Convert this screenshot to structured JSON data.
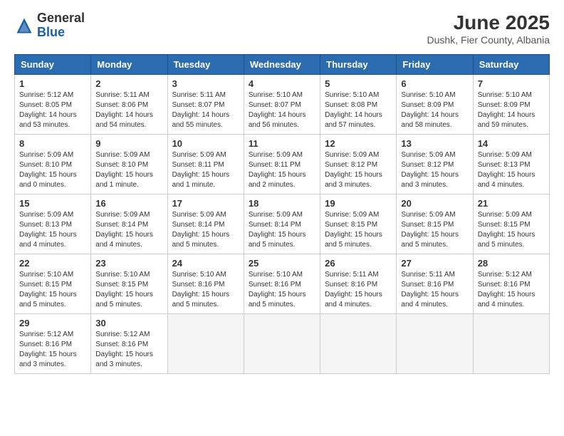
{
  "header": {
    "logo_general": "General",
    "logo_blue": "Blue",
    "title": "June 2025",
    "subtitle": "Dushk, Fier County, Albania"
  },
  "weekdays": [
    "Sunday",
    "Monday",
    "Tuesday",
    "Wednesday",
    "Thursday",
    "Friday",
    "Saturday"
  ],
  "weeks": [
    [
      {
        "day": "1",
        "info": "Sunrise: 5:12 AM\nSunset: 8:05 PM\nDaylight: 14 hours\nand 53 minutes."
      },
      {
        "day": "2",
        "info": "Sunrise: 5:11 AM\nSunset: 8:06 PM\nDaylight: 14 hours\nand 54 minutes."
      },
      {
        "day": "3",
        "info": "Sunrise: 5:11 AM\nSunset: 8:07 PM\nDaylight: 14 hours\nand 55 minutes."
      },
      {
        "day": "4",
        "info": "Sunrise: 5:10 AM\nSunset: 8:07 PM\nDaylight: 14 hours\nand 56 minutes."
      },
      {
        "day": "5",
        "info": "Sunrise: 5:10 AM\nSunset: 8:08 PM\nDaylight: 14 hours\nand 57 minutes."
      },
      {
        "day": "6",
        "info": "Sunrise: 5:10 AM\nSunset: 8:09 PM\nDaylight: 14 hours\nand 58 minutes."
      },
      {
        "day": "7",
        "info": "Sunrise: 5:10 AM\nSunset: 8:09 PM\nDaylight: 14 hours\nand 59 minutes."
      }
    ],
    [
      {
        "day": "8",
        "info": "Sunrise: 5:09 AM\nSunset: 8:10 PM\nDaylight: 15 hours\nand 0 minutes."
      },
      {
        "day": "9",
        "info": "Sunrise: 5:09 AM\nSunset: 8:10 PM\nDaylight: 15 hours\nand 1 minute."
      },
      {
        "day": "10",
        "info": "Sunrise: 5:09 AM\nSunset: 8:11 PM\nDaylight: 15 hours\nand 1 minute."
      },
      {
        "day": "11",
        "info": "Sunrise: 5:09 AM\nSunset: 8:11 PM\nDaylight: 15 hours\nand 2 minutes."
      },
      {
        "day": "12",
        "info": "Sunrise: 5:09 AM\nSunset: 8:12 PM\nDaylight: 15 hours\nand 3 minutes."
      },
      {
        "day": "13",
        "info": "Sunrise: 5:09 AM\nSunset: 8:12 PM\nDaylight: 15 hours\nand 3 minutes."
      },
      {
        "day": "14",
        "info": "Sunrise: 5:09 AM\nSunset: 8:13 PM\nDaylight: 15 hours\nand 4 minutes."
      }
    ],
    [
      {
        "day": "15",
        "info": "Sunrise: 5:09 AM\nSunset: 8:13 PM\nDaylight: 15 hours\nand 4 minutes."
      },
      {
        "day": "16",
        "info": "Sunrise: 5:09 AM\nSunset: 8:14 PM\nDaylight: 15 hours\nand 4 minutes."
      },
      {
        "day": "17",
        "info": "Sunrise: 5:09 AM\nSunset: 8:14 PM\nDaylight: 15 hours\nand 5 minutes."
      },
      {
        "day": "18",
        "info": "Sunrise: 5:09 AM\nSunset: 8:14 PM\nDaylight: 15 hours\nand 5 minutes."
      },
      {
        "day": "19",
        "info": "Sunrise: 5:09 AM\nSunset: 8:15 PM\nDaylight: 15 hours\nand 5 minutes."
      },
      {
        "day": "20",
        "info": "Sunrise: 5:09 AM\nSunset: 8:15 PM\nDaylight: 15 hours\nand 5 minutes."
      },
      {
        "day": "21",
        "info": "Sunrise: 5:09 AM\nSunset: 8:15 PM\nDaylight: 15 hours\nand 5 minutes."
      }
    ],
    [
      {
        "day": "22",
        "info": "Sunrise: 5:10 AM\nSunset: 8:15 PM\nDaylight: 15 hours\nand 5 minutes."
      },
      {
        "day": "23",
        "info": "Sunrise: 5:10 AM\nSunset: 8:15 PM\nDaylight: 15 hours\nand 5 minutes."
      },
      {
        "day": "24",
        "info": "Sunrise: 5:10 AM\nSunset: 8:16 PM\nDaylight: 15 hours\nand 5 minutes."
      },
      {
        "day": "25",
        "info": "Sunrise: 5:10 AM\nSunset: 8:16 PM\nDaylight: 15 hours\nand 5 minutes."
      },
      {
        "day": "26",
        "info": "Sunrise: 5:11 AM\nSunset: 8:16 PM\nDaylight: 15 hours\nand 4 minutes."
      },
      {
        "day": "27",
        "info": "Sunrise: 5:11 AM\nSunset: 8:16 PM\nDaylight: 15 hours\nand 4 minutes."
      },
      {
        "day": "28",
        "info": "Sunrise: 5:12 AM\nSunset: 8:16 PM\nDaylight: 15 hours\nand 4 minutes."
      }
    ],
    [
      {
        "day": "29",
        "info": "Sunrise: 5:12 AM\nSunset: 8:16 PM\nDaylight: 15 hours\nand 3 minutes."
      },
      {
        "day": "30",
        "info": "Sunrise: 5:12 AM\nSunset: 8:16 PM\nDaylight: 15 hours\nand 3 minutes."
      },
      null,
      null,
      null,
      null,
      null
    ]
  ]
}
